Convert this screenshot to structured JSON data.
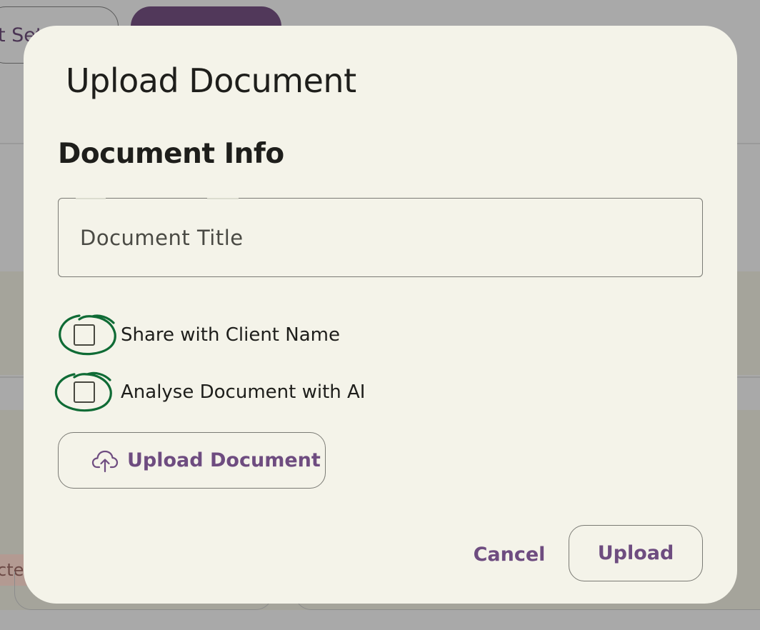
{
  "background": {
    "button_outline_label": "t Sett",
    "badge_label": "cted"
  },
  "dialog": {
    "title": "Upload Document",
    "section_heading": "Document Info",
    "title_field": {
      "placeholder": "Document Title",
      "value": ""
    },
    "checkboxes": [
      {
        "label": "Share with Client Name",
        "checked": false
      },
      {
        "label": "Analyse Document with AI",
        "checked": false
      }
    ],
    "upload_document_button": {
      "icon": "cloud-upload-icon",
      "label": "Upload Document"
    },
    "actions": {
      "cancel_label": "Cancel",
      "upload_label": "Upload"
    }
  },
  "colors": {
    "overlay": "#a9a9a9",
    "dialog_background": "#f4f3e9",
    "accent": "#6e4c80",
    "annotation_ring": "#0f6b35",
    "text": "#1e1e1b"
  }
}
